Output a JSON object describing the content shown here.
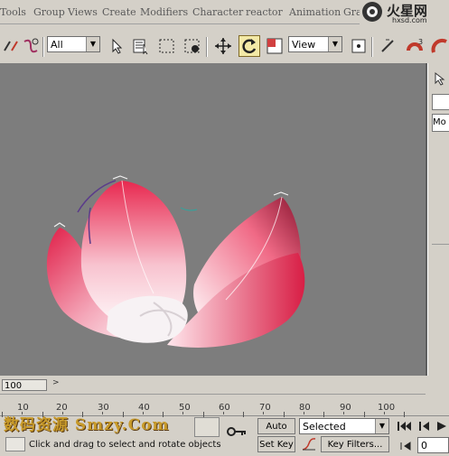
{
  "menu": {
    "items": [
      "Tools",
      "Group",
      "Views",
      "Create",
      "Modifiers",
      "Character",
      "reactor",
      "Animation",
      "Graph"
    ]
  },
  "logo": {
    "text": "火星网",
    "subtext": "hxsd.com"
  },
  "toolbar": {
    "selection_filter": "All",
    "ref_coord": "View"
  },
  "panel": {
    "label": "Mo"
  },
  "timeslider": {
    "value": "100",
    "next": ">"
  },
  "trackbar": {
    "ticks": [
      "10",
      "20",
      "30",
      "40",
      "50",
      "60",
      "70",
      "80",
      "90",
      "100"
    ]
  },
  "watermark": "数码资源 Smzy.Com",
  "status": {
    "prompt": "Click and drag to select and rotate objects",
    "auto_key": "Auto Key",
    "set_key": "Set Key",
    "key_mode": "Selected",
    "key_filters": "Key Filters...",
    "frame": "0"
  },
  "colors": {
    "viewport_bg": "#7d7d7d",
    "petal": "#e8284f",
    "ui_gray": "#d4d0c8"
  }
}
